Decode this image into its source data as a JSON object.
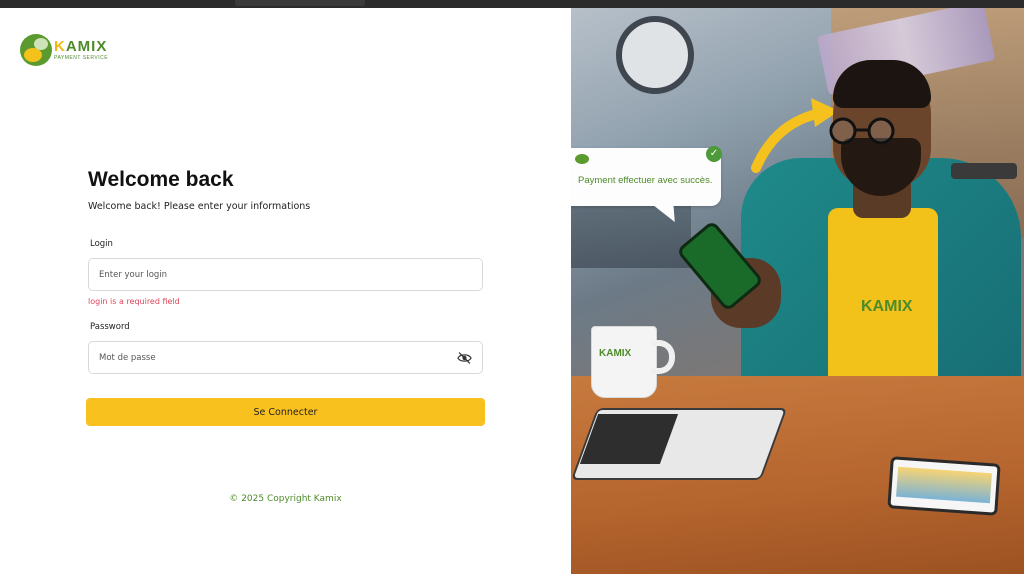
{
  "brand": {
    "name_prefix": "K",
    "name_rest": "AMIX",
    "tagline": "PAYMENT SERVICE"
  },
  "form": {
    "title": "Welcome back",
    "subtitle": "Welcome back! Please enter your informations",
    "login_label": "Login",
    "login_placeholder": "Enter your login",
    "login_error": "login is a required field",
    "password_label": "Password",
    "password_placeholder": "Mot de passe",
    "password_toggle_icon": "eye-slash-icon",
    "submit_label": "Se Connecter"
  },
  "footer": {
    "copyright": "© 2025 Copyright Kamix"
  },
  "illustration": {
    "bubble_text": "Payment effectuer avec succès.",
    "bubble_check": "✓",
    "shirt_logo": "KAMIX",
    "mug_logo": "KAMIX"
  },
  "colors": {
    "accent": "#f9c11e",
    "brand_green": "#4e8b2a",
    "error": "#e0455a"
  }
}
